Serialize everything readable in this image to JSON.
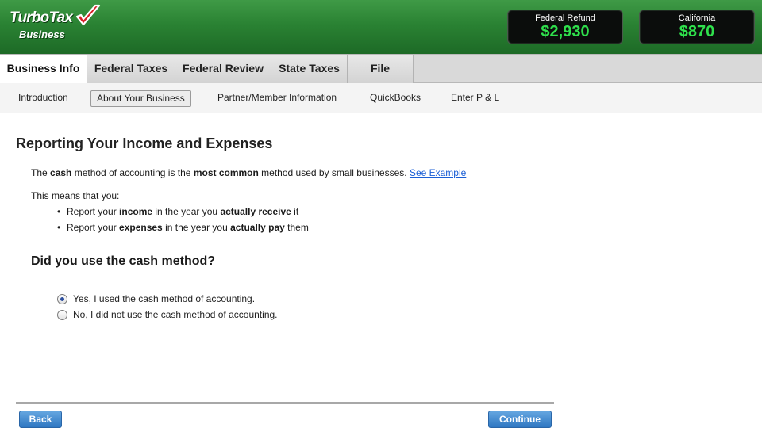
{
  "header": {
    "logo_main": "TurboTax",
    "logo_sub": "Business",
    "federal": {
      "label": "Federal Refund",
      "amount": "$2,930"
    },
    "state": {
      "label": "California",
      "amount": "$870"
    },
    "colors": {
      "header_green": "#2a8233",
      "refund_green": "#2fe04c"
    }
  },
  "tabs": [
    {
      "label": "Business Info",
      "active": true
    },
    {
      "label": "Federal Taxes",
      "active": false
    },
    {
      "label": "Federal Review",
      "active": false
    },
    {
      "label": "State Taxes",
      "active": false
    },
    {
      "label": "File",
      "active": false
    }
  ],
  "subnav": [
    {
      "label": "Introduction",
      "active": false
    },
    {
      "label": "About Your Business",
      "active": true
    },
    {
      "label": "Partner/Member Information",
      "active": false
    },
    {
      "label": "QuickBooks",
      "active": false
    },
    {
      "label": "Enter P & L",
      "active": false
    }
  ],
  "content": {
    "title": "Reporting Your Income and Expenses",
    "intro": {
      "t1": "The ",
      "b1": "cash",
      "t2": " method of accounting is the ",
      "b2": "most common",
      "t3": " method used by small businesses. ",
      "link": "See Example"
    },
    "means": "This means that you:",
    "bullets": [
      {
        "t1": "Report your ",
        "b1": "income",
        "t2": " in the year you ",
        "b2": "actually receive",
        "t3": " it"
      },
      {
        "t1": "Report your ",
        "b1": "expenses",
        "t2": " in the year you ",
        "b2": "actually pay",
        "t3": " them"
      }
    ],
    "question": "Did you use the cash method?",
    "options": [
      {
        "label": "Yes, I used the cash method of accounting.",
        "checked": true
      },
      {
        "label": "No, I did not use the cash method of accounting.",
        "checked": false
      }
    ]
  },
  "buttons": {
    "back": "Back",
    "continue": "Continue"
  }
}
